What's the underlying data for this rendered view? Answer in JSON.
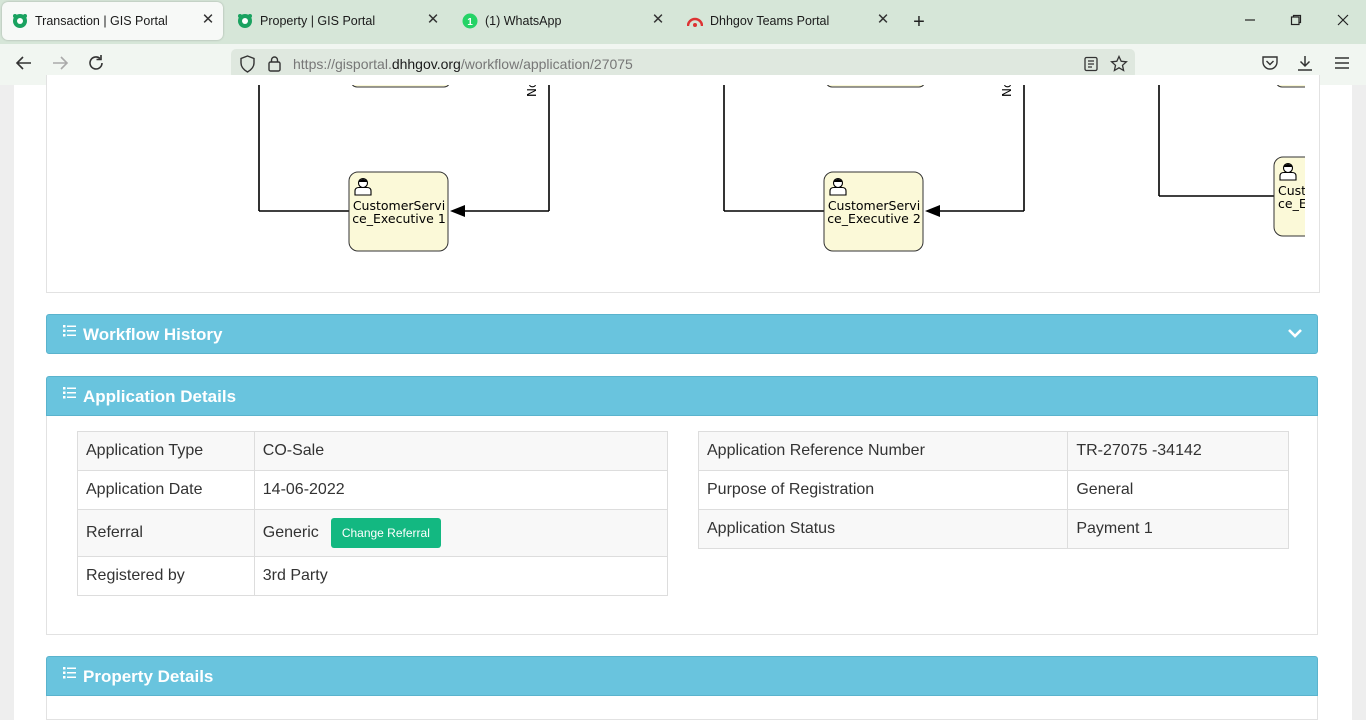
{
  "browser": {
    "tabs": [
      {
        "title": "Transaction | GIS Portal",
        "active": true,
        "icon": "gis-portal-icon"
      },
      {
        "title": "Property | GIS Portal",
        "active": false,
        "icon": "gis-portal-icon"
      },
      {
        "title": "(1) WhatsApp",
        "active": false,
        "icon": "whatsapp-icon",
        "badge": "1"
      },
      {
        "title": "Dhhgov Teams Portal",
        "active": false,
        "icon": "teams-portal-icon"
      }
    ],
    "close_glyph": "✕",
    "new_tab_glyph": "+",
    "url_prefix": "https://gisportal.",
    "url_host": "dhhgov.org",
    "url_path": "/workflow/application/27075"
  },
  "workflow_diagram": {
    "nodes": [
      {
        "label_line1": "CustomerServi",
        "label_line2": "ce_Executive 1"
      },
      {
        "label_line1": "CustomerServi",
        "label_line2": "ce_Executive 2"
      },
      {
        "label_line1": "Cust",
        "label_line2": "ce_E"
      }
    ],
    "edge_label": "No"
  },
  "workflow_history": {
    "title": "Workflow History"
  },
  "application_details": {
    "title": "Application Details",
    "left_rows": [
      {
        "label": "Application Type",
        "value": "CO-Sale"
      },
      {
        "label": "Application Date",
        "value": "14-06-2022"
      },
      {
        "label": "Referral",
        "value": "Generic"
      },
      {
        "label": "Registered by",
        "value": "3rd Party"
      }
    ],
    "change_referral_label": "Change Referral",
    "right_rows": [
      {
        "label": "Application Reference Number",
        "value": "TR-27075 -34142"
      },
      {
        "label": "Purpose of Registration",
        "value": "General"
      },
      {
        "label": "Application Status",
        "value": "Payment 1"
      }
    ]
  },
  "property_details": {
    "title": "Property Details"
  },
  "colors": {
    "panel_header": "#69c4de",
    "button_green": "#13b881",
    "node_fill": "#fbf9d8"
  }
}
